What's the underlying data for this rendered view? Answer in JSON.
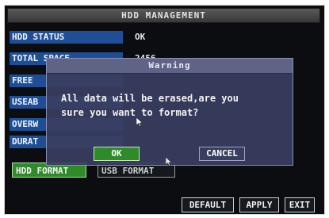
{
  "window": {
    "title": "HDD MANAGEMENT"
  },
  "rows": [
    {
      "label": "HDD STATUS",
      "value": "OK"
    },
    {
      "label": "TOTAL SPACE",
      "value": "2456"
    },
    {
      "label": "FREE",
      "value": ""
    },
    {
      "label": "USEAB",
      "value": ""
    },
    {
      "label": "OVERW",
      "value": ""
    },
    {
      "label": "DURAT",
      "value": ""
    }
  ],
  "buttons": {
    "hdd_format": "HDD FORMAT",
    "usb_format": "USB FORMAT",
    "default": "DEFAULT",
    "apply": "APPLY",
    "exit": "EXIT"
  },
  "dialog": {
    "title": "Warning",
    "message_line1": "All data will be erased,are you",
    "message_line2": "sure you want to format?",
    "ok": "OK",
    "cancel": "CANCEL"
  },
  "colors": {
    "screen_bg": "#0b0d10",
    "label_bg": "#1e4f96",
    "accent_green": "#2f8a2a",
    "dialog_bg": "#3a3e60"
  },
  "icons": {
    "cursor": "mouse-pointer-icon"
  }
}
